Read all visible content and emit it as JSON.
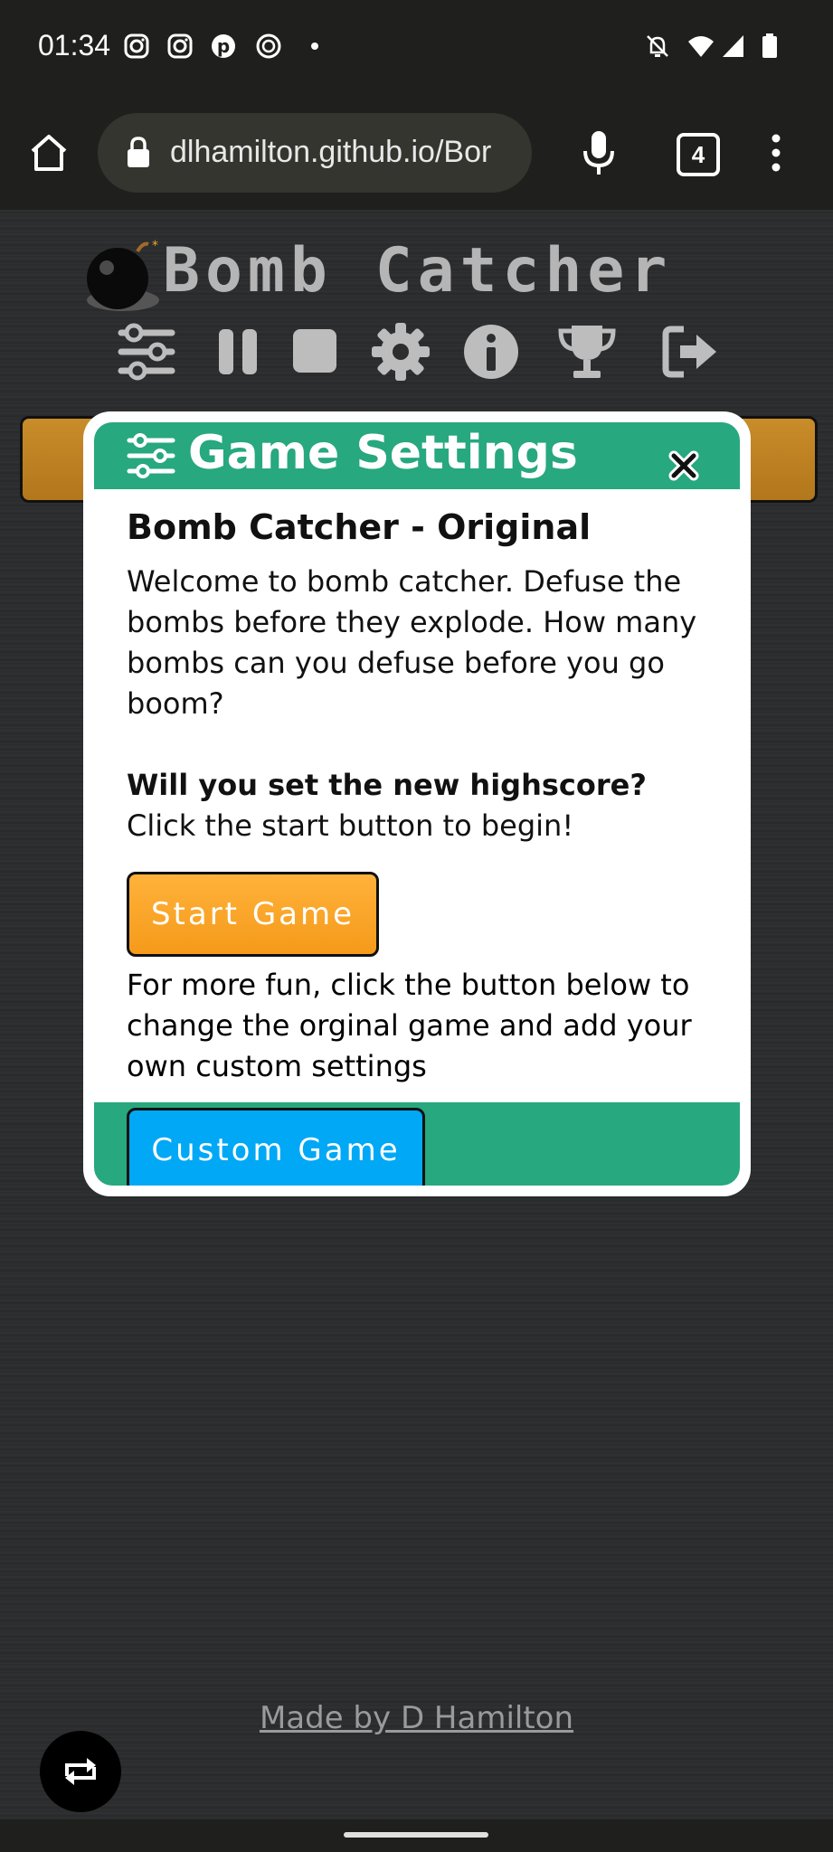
{
  "status_bar": {
    "time": "01:34",
    "left_icons": [
      "instagram-icon",
      "instagram-icon",
      "pinterest-icon",
      "threads-icon",
      "dot-icon"
    ],
    "right_icons": [
      "bell-off-icon",
      "wifi-icon",
      "signal-icon",
      "battery-icon"
    ]
  },
  "browser": {
    "url": "dlhamilton.github.io/Bor",
    "tab_count": "4",
    "icons": [
      "home-icon",
      "lock-icon",
      "mic-icon",
      "tabs-icon",
      "more-vert-icon"
    ]
  },
  "page": {
    "title": "Bomb Catcher",
    "toolbar_icons": [
      "sliders-icon",
      "pause-icon",
      "stop-icon",
      "gear-icon",
      "info-icon",
      "trophy-icon",
      "exit-icon"
    ],
    "footer_link": "Made by D Hamilton"
  },
  "modal": {
    "title": "Game Settings",
    "heading": "Bomb Catcher - Original",
    "intro": "Welcome to bomb catcher. Defuse the bombs before they explode. How many bombs can you defuse before you go boom?",
    "question": "Will you set the new highscore?",
    "instruction": "Click the start button to begin!",
    "start_label": "Start Game",
    "more_text": "For more fun, click the button below to change the orginal game and add your own custom settings",
    "custom_label": "Custom Game"
  },
  "colors": {
    "header_green": "#27a87e",
    "start_orange": "#f59a1a",
    "custom_blue": "#00a8f5",
    "page_bg": "#2d2e30"
  }
}
